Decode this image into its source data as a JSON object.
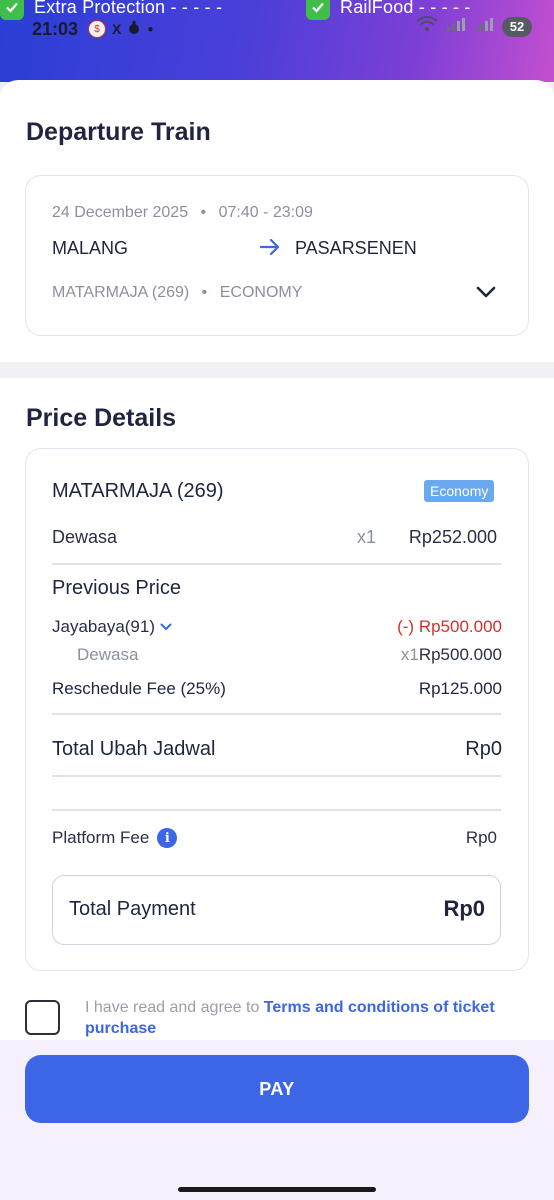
{
  "status_bar": {
    "banner_left": "Extra Protection  - - - - -",
    "banner_right": "RailFood  - - - - -",
    "time": "21:03",
    "battery": "52",
    "x_glyph": "X"
  },
  "departure": {
    "title": "Departure Train",
    "date": "24 December 2025",
    "time_range": "07:40 - 23:09",
    "origin": "MALANG",
    "destination": "PASARSENEN",
    "train": "MATARMAJA (269)",
    "class": "ECONOMY",
    "bullet": "•"
  },
  "price_details": {
    "title": "Price Details",
    "train": "MATARMAJA (269)",
    "class_badge": "Economy",
    "passenger_label": "Dewasa",
    "passenger_qty": "x1",
    "passenger_price": "Rp252.000",
    "previous_title": "Previous Price",
    "previous_train": "Jayabaya(91)",
    "previous_amount": "(-) Rp500.000",
    "previous_passenger": "Dewasa",
    "previous_qty": "x1",
    "previous_passenger_price": "Rp500.000",
    "reschedule_label": "Reschedule Fee (25%)",
    "reschedule_amount": "Rp125.000",
    "total_change_label": "Total Ubah Jadwal",
    "total_change_amount": "Rp0",
    "platform_fee_label": "Platform Fee",
    "platform_fee_amount": "Rp0",
    "total_payment_label": "Total Payment",
    "total_payment_amount": "Rp0"
  },
  "agreement": {
    "text": "I have read and agree to ",
    "link": "Terms and conditions of ticket purchase"
  },
  "pay_button": "PAY",
  "colors": {
    "accent": "#3d66e6",
    "negative": "#d0312d",
    "badge": "#6aa8f0",
    "title": "#1f2540"
  }
}
